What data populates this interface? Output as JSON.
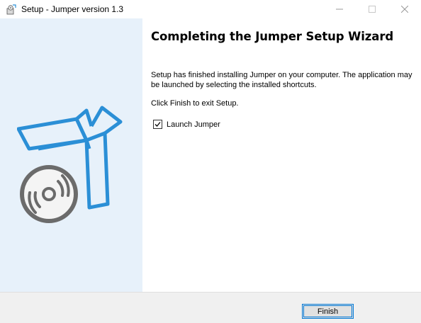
{
  "window": {
    "title": "Setup - Jumper version 1.3",
    "icons": {
      "app": "installer-icon",
      "minimize": "minimize-icon",
      "maximize": "maximize-icon",
      "close": "close-icon"
    }
  },
  "side_panel": {
    "illustration": "box-with-disc-illustration",
    "accent": "#2b8fd6"
  },
  "content": {
    "heading": "Completing the Jumper Setup Wizard",
    "paragraph1": "Setup has finished installing Jumper on your computer. The application may be launched by selecting the installed shortcuts.",
    "paragraph2": "Click Finish to exit Setup.",
    "launch_checkbox": {
      "label": "Launch Jumper",
      "checked": true
    }
  },
  "footer": {
    "finish_label": "Finish"
  },
  "colors": {
    "panel_bg": "#e7f1fa",
    "button_border": "#0078d7",
    "footer_bg": "#f0f0f0"
  }
}
